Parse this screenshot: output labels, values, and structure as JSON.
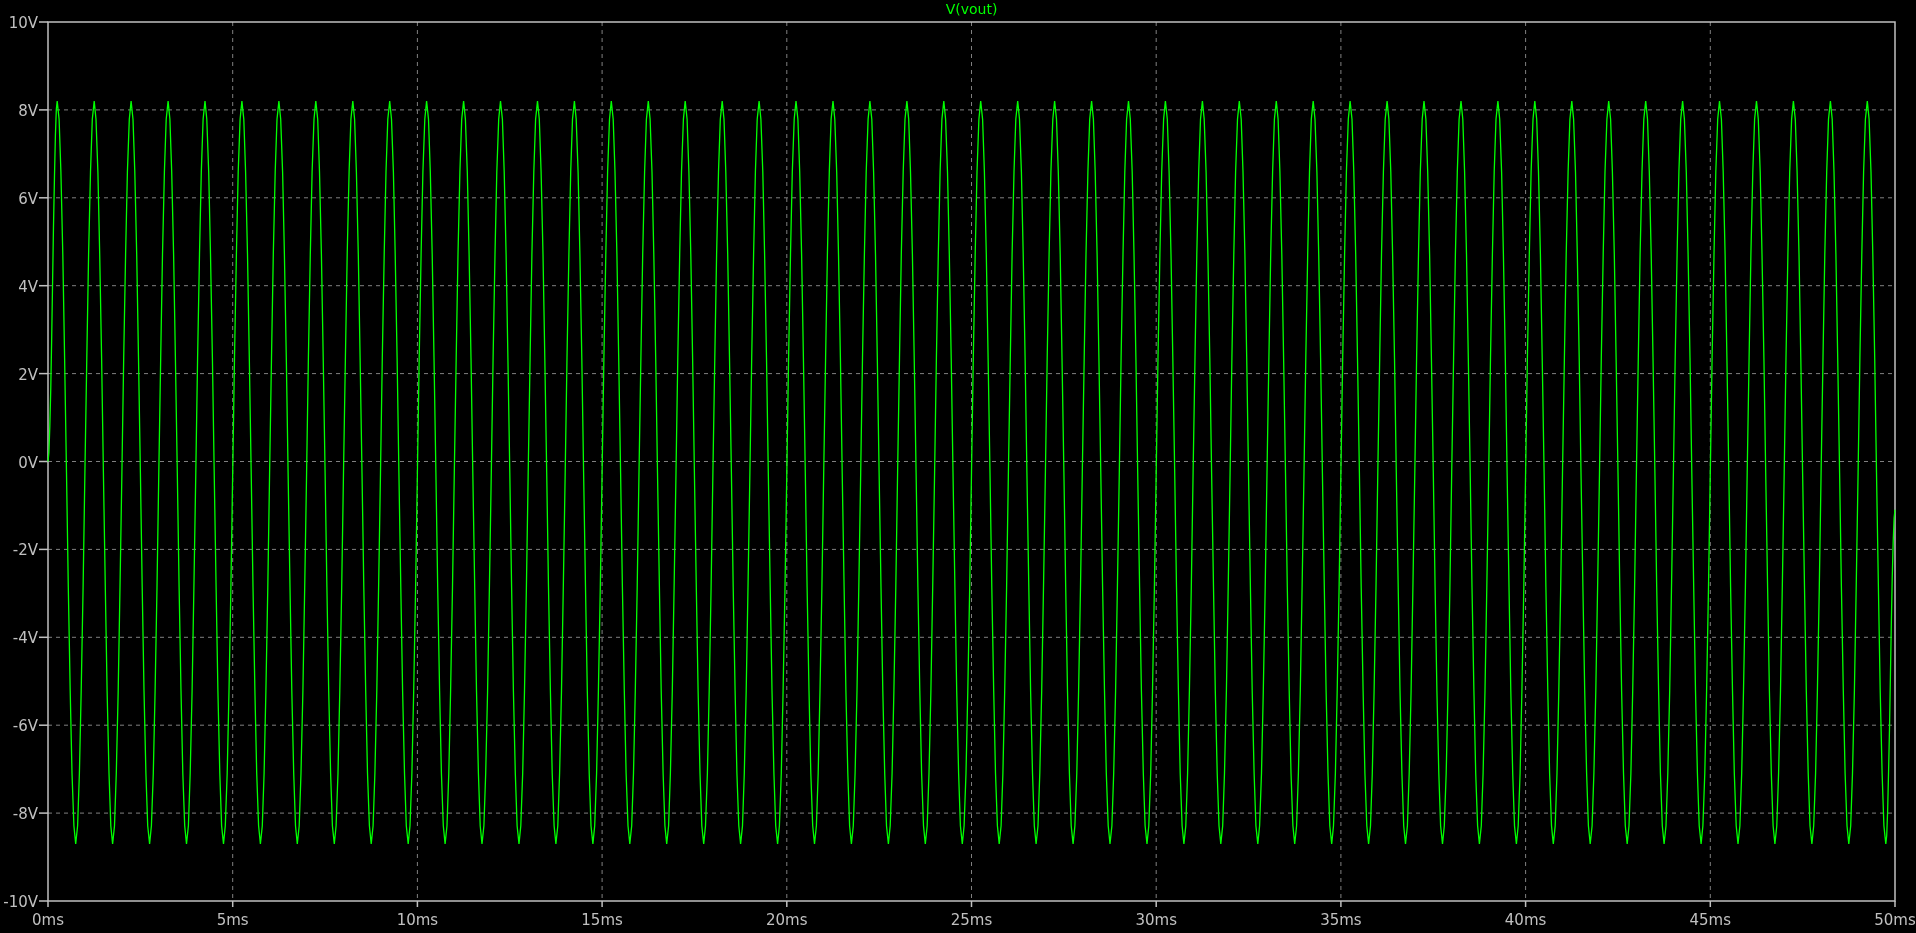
{
  "chart_data": {
    "type": "line",
    "grid": true,
    "xlim": [
      0,
      50
    ],
    "ylim": [
      -10,
      10
    ],
    "xticks": [
      {
        "value": 0,
        "label": "0ms"
      },
      {
        "value": 5,
        "label": "5ms"
      },
      {
        "value": 10,
        "label": "10ms"
      },
      {
        "value": 15,
        "label": "15ms"
      },
      {
        "value": 20,
        "label": "20ms"
      },
      {
        "value": 25,
        "label": "25ms"
      },
      {
        "value": 30,
        "label": "30ms"
      },
      {
        "value": 35,
        "label": "35ms"
      },
      {
        "value": 40,
        "label": "40ms"
      },
      {
        "value": 45,
        "label": "45ms"
      },
      {
        "value": 50,
        "label": "50ms"
      }
    ],
    "yticks": [
      {
        "value": 10,
        "label": "10V"
      },
      {
        "value": 8,
        "label": "8V"
      },
      {
        "value": 6,
        "label": "6V"
      },
      {
        "value": 4,
        "label": "4V"
      },
      {
        "value": 2,
        "label": "2V"
      },
      {
        "value": 0,
        "label": "0V"
      },
      {
        "value": -2,
        "label": "-2V"
      },
      {
        "value": -4,
        "label": "-4V"
      },
      {
        "value": -6,
        "label": "-6V"
      },
      {
        "value": -8,
        "label": "-8V"
      },
      {
        "value": -10,
        "label": "-10V"
      }
    ],
    "x": [
      0,
      0.25,
      0.75,
      1.25,
      1.75,
      2.25,
      2.75,
      3.25,
      3.75,
      4.25,
      4.75,
      5.25,
      5.75,
      6.25,
      6.75,
      7.25,
      7.75,
      8.25,
      8.75,
      9.25,
      9.75,
      10.25,
      10.75,
      11.25,
      11.75,
      12.25,
      12.75,
      13.25,
      13.75,
      14.25,
      14.75,
      15.25,
      15.75,
      16.25,
      16.75,
      17.25,
      17.75,
      18.25,
      18.75,
      19.25,
      19.75,
      20.25,
      20.75,
      21.25,
      21.75,
      22.25,
      22.75,
      23.25,
      23.75,
      24.25,
      24.75,
      25.25,
      25.75,
      26.25,
      26.75,
      27.25,
      27.75,
      28.25,
      28.75,
      29.25,
      29.75,
      30.25,
      30.75,
      31.25,
      31.75,
      32.25,
      32.75,
      33.25,
      33.75,
      34.25,
      34.75,
      35.25,
      35.75,
      36.25,
      36.75,
      37.25,
      37.75,
      38.25,
      38.75,
      39.25,
      39.75,
      40.25,
      40.75,
      41.25,
      41.75,
      42.25,
      42.75,
      43.25,
      43.75,
      44.25,
      44.75,
      45.25,
      45.75,
      46.25,
      46.75,
      47.25,
      47.75,
      48.25,
      48.75,
      49.25,
      49.75,
      50
    ],
    "series": [
      {
        "name": "V(vout)",
        "color": "#00ff00",
        "values": [
          0,
          8.2,
          -8.7,
          8.2,
          -8.7,
          8.2,
          -8.7,
          8.2,
          -8.7,
          8.2,
          -8.7,
          8.2,
          -8.7,
          8.2,
          -8.7,
          8.2,
          -8.7,
          8.2,
          -8.7,
          8.2,
          -8.7,
          8.2,
          -8.7,
          8.2,
          -8.7,
          8.2,
          -8.7,
          8.2,
          -8.7,
          8.2,
          -8.7,
          8.2,
          -8.7,
          8.2,
          -8.7,
          8.2,
          -8.7,
          8.2,
          -8.7,
          8.2,
          -8.7,
          8.2,
          -8.7,
          8.2,
          -8.7,
          8.2,
          -8.7,
          8.2,
          -8.7,
          8.2,
          -8.7,
          8.2,
          -8.7,
          8.2,
          -8.7,
          8.2,
          -8.7,
          8.2,
          -8.7,
          8.2,
          -8.7,
          8.2,
          -8.7,
          8.2,
          -8.7,
          8.2,
          -8.7,
          8.2,
          -8.7,
          8.2,
          -8.7,
          8.2,
          -8.7,
          8.2,
          -8.7,
          8.2,
          -8.7,
          8.2,
          -8.7,
          8.2,
          -8.7,
          8.2,
          -8.7,
          8.2,
          -8.7,
          8.2,
          -8.7,
          8.2,
          -8.7,
          8.2,
          -8.7,
          8.2,
          -8.7,
          8.2,
          -8.7,
          8.2,
          -8.7,
          8.2,
          -8.7,
          8.2,
          -8.7,
          -1.1
        ]
      }
    ]
  }
}
